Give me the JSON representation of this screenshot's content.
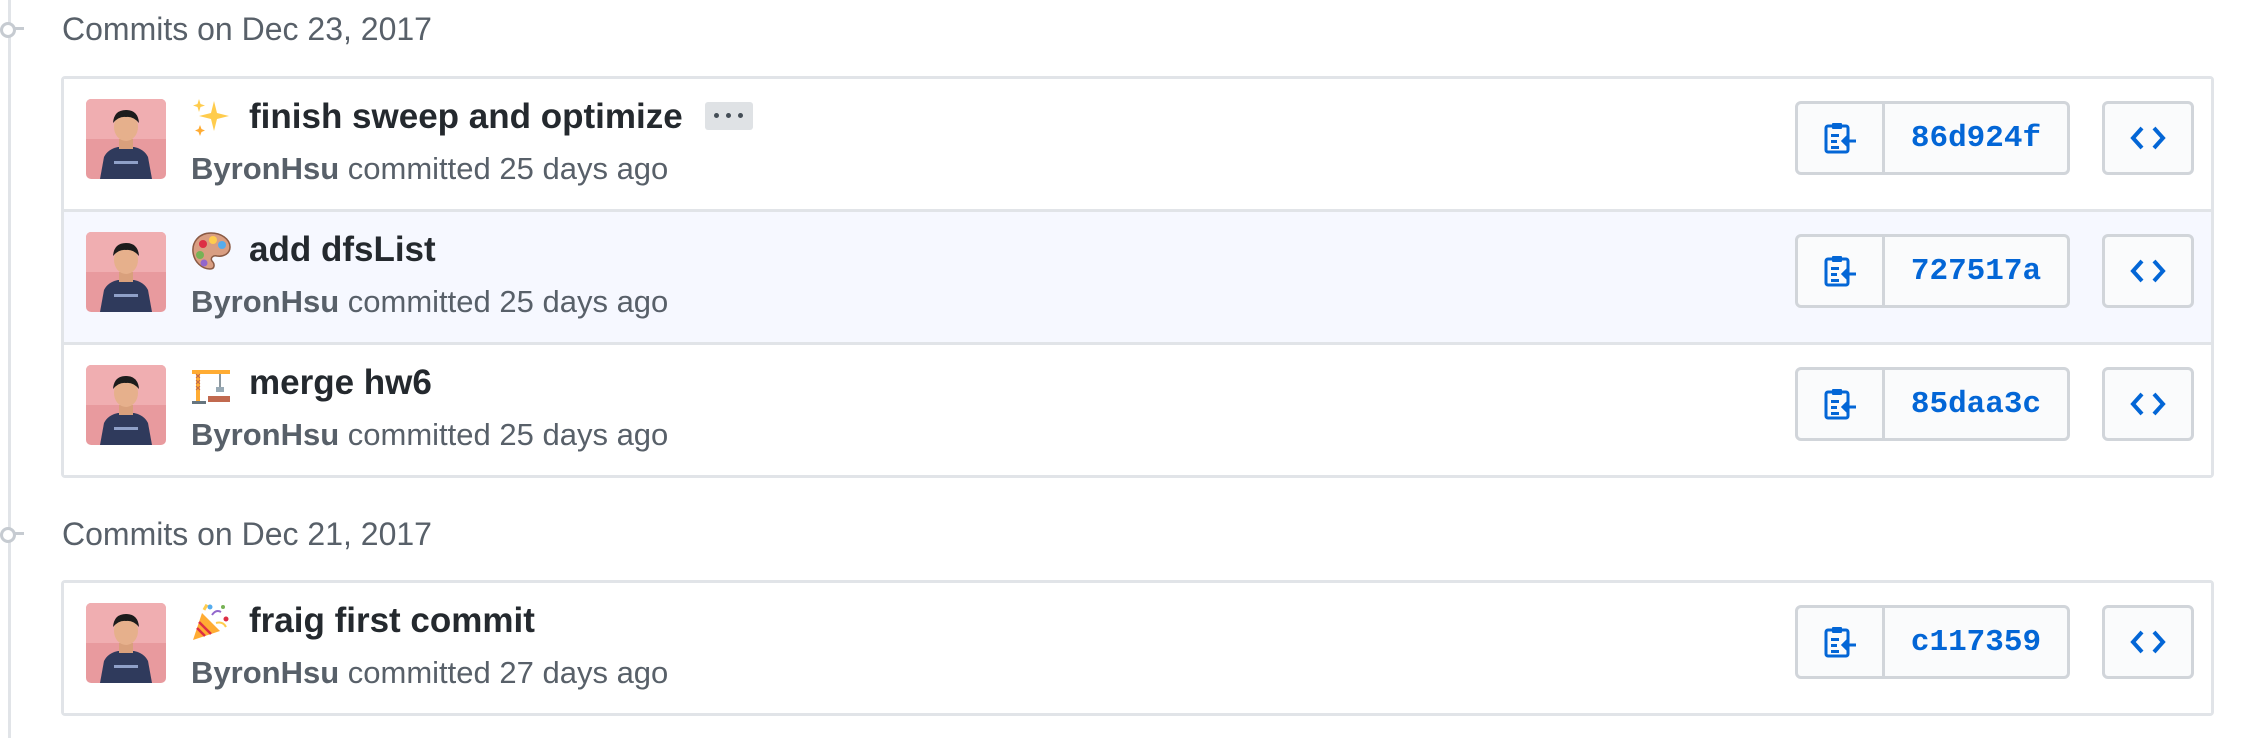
{
  "groups": [
    {
      "date_label": "Commits on Dec 23, 2017",
      "commits": [
        {
          "emoji": "sparkles-icon",
          "title": "finish sweep and optimize",
          "author": "ByronHsu",
          "action": "committed",
          "time": "25 days ago",
          "sha": "86d924f",
          "has_ellipsis": true
        },
        {
          "emoji": "palette-icon",
          "title": "add dfsList",
          "author": "ByronHsu",
          "action": "committed",
          "time": "25 days ago",
          "sha": "727517a",
          "highlighted": true
        },
        {
          "emoji": "construction-icon",
          "title": "merge hw6",
          "author": "ByronHsu",
          "action": "committed",
          "time": "25 days ago",
          "sha": "85daa3c"
        }
      ]
    },
    {
      "date_label": "Commits on Dec 21, 2017",
      "commits": [
        {
          "emoji": "party-popper-icon",
          "title": "fraig first commit",
          "author": "ByronHsu",
          "action": "committed",
          "time": "27 days ago",
          "sha": "c117359"
        }
      ]
    }
  ],
  "colors": {
    "link": "#0366d6",
    "highlight_row": "#f6f8ff",
    "muted_text": "#586069",
    "border": "#e1e4e8"
  }
}
